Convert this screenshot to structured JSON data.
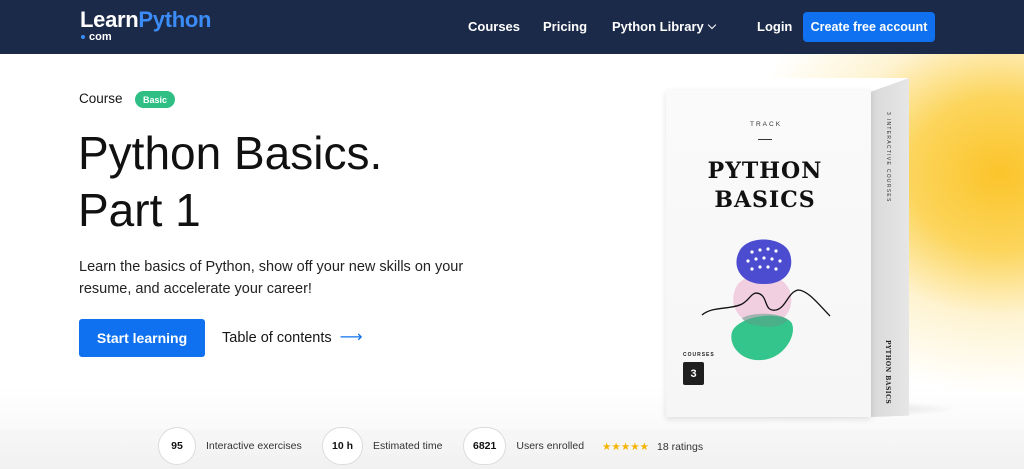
{
  "nav": {
    "logo_prefix": "Learn",
    "logo_accent": "Python",
    "logo_suffix": "com",
    "links": [
      "Courses",
      "Pricing",
      "Python Library"
    ],
    "login": "Login",
    "create_account": "Create free account",
    "colors": {
      "bar": "#1b2a48",
      "accent": "#0f71ef"
    }
  },
  "hero": {
    "course_label": "Course",
    "badge": "Basic",
    "title_line1": "Python Basics.",
    "title_line2": "Part 1",
    "description": "Learn the basics of Python, show off your new skills on your resume, and accelerate your career!",
    "start_button": "Start learning",
    "toc_link": "Table of contents",
    "toc_arrow": "⟶"
  },
  "box": {
    "track": "TRACK",
    "title_line1": "PYTHON",
    "title_line2": "BASICS",
    "courses_label": "COURSES",
    "courses_count": "3",
    "side_top": "3 INTERACTIVE COURSES",
    "side_bottom": "PYTHON BASICS"
  },
  "stats": [
    {
      "value": "95",
      "label": "Interactive exercises"
    },
    {
      "value": "10 h",
      "label": "Estimated time"
    },
    {
      "value": "6821",
      "label": "Users enrolled"
    }
  ],
  "rating": {
    "stars": "★★★★★",
    "count_label": "18 ratings"
  }
}
